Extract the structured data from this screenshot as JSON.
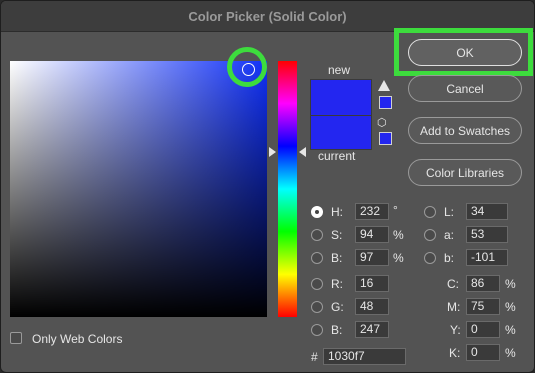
{
  "window": {
    "title": "Color Picker (Solid Color)"
  },
  "buttons": {
    "ok": "OK",
    "cancel": "Cancel",
    "add_swatches": "Add to Swatches",
    "libraries": "Color Libraries"
  },
  "preview": {
    "new_label": "new",
    "current_label": "current",
    "new_color": "#2326f0",
    "current_color": "#2326f0"
  },
  "hsb": {
    "h_label": "H:",
    "h": "232",
    "h_unit": "°",
    "s_label": "S:",
    "s": "94",
    "s_unit": "%",
    "b_label": "B:",
    "b": "97",
    "b_unit": "%"
  },
  "rgb": {
    "r_label": "R:",
    "r": "16",
    "g_label": "G:",
    "g": "48",
    "b_label": "B:",
    "b": "247"
  },
  "lab": {
    "l_label": "L:",
    "l": "34",
    "a_label": "a:",
    "a": "53",
    "b_label": "b:",
    "b": "-101"
  },
  "cmyk": {
    "c_label": "C:",
    "c": "86",
    "m_label": "M:",
    "m": "75",
    "y_label": "Y:",
    "y": "0",
    "k_label": "K:",
    "k": "0",
    "unit": "%"
  },
  "hex": {
    "label": "#",
    "value": "1030f7"
  },
  "web_colors": {
    "label": "Only Web Colors",
    "checked": false
  },
  "accent_highlight": "#3ddc3d"
}
